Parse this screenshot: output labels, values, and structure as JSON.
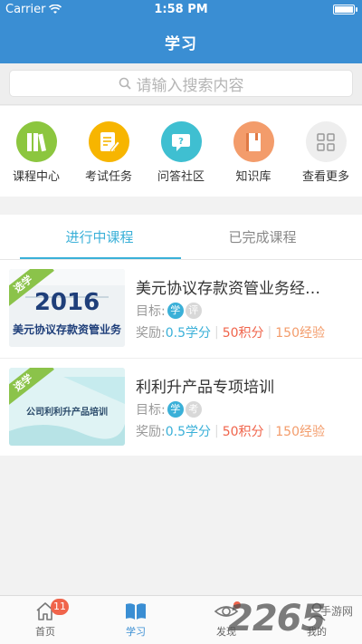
{
  "status": {
    "carrier": "Carrier",
    "time": "1:58 PM"
  },
  "header": {
    "title": "学习"
  },
  "search": {
    "placeholder": "请输入搜索内容"
  },
  "quick_links": [
    {
      "label": "课程中心",
      "icon": "books-icon",
      "color": "#8cc63f"
    },
    {
      "label": "考试任务",
      "icon": "exam-icon",
      "color": "#f7b500"
    },
    {
      "label": "问答社区",
      "icon": "qa-icon",
      "color": "#3fbfd1"
    },
    {
      "label": "知识库",
      "icon": "book-icon",
      "color": "#f39c6b"
    },
    {
      "label": "查看更多",
      "icon": "grid-icon",
      "color": "#eeeeee"
    }
  ],
  "tabs": [
    {
      "label": "进行中课程",
      "active": true
    },
    {
      "label": "已完成课程",
      "active": false
    }
  ],
  "courses": [
    {
      "title": "美元协议存款资管业务经…",
      "ribbon": "选学",
      "thumb_year": "2016",
      "thumb_text": "美元协议存款资管业务",
      "target_label": "目标:",
      "chip1": "学",
      "chip2": "评",
      "reward_label": "奖励:",
      "credit": "0.5学分",
      "points": "50积分",
      "exp": "150经验"
    },
    {
      "title": "利利升产品专项培训",
      "ribbon": "选学",
      "thumb_text": "公司利利升产品培训",
      "target_label": "目标:",
      "chip1": "学",
      "chip2": "考",
      "reward_label": "奖励:",
      "credit": "0.5学分",
      "points": "50积分",
      "exp": "150经验"
    }
  ],
  "bottom_nav": [
    {
      "label": "首页",
      "icon": "home-icon",
      "badge": "11"
    },
    {
      "label": "学习",
      "icon": "study-book-icon",
      "active": true
    },
    {
      "label": "发现",
      "icon": "eye-icon",
      "dot": true
    },
    {
      "label": "我的",
      "icon": "user-icon"
    }
  ],
  "watermark": {
    "main": "2265",
    "sub": "手游网"
  },
  "colors": {
    "header": "#3a8ed3",
    "accent": "#3ab0d8",
    "points": "#f0644b",
    "exp": "#f39c6b",
    "ribbon": "#8bc34a"
  }
}
